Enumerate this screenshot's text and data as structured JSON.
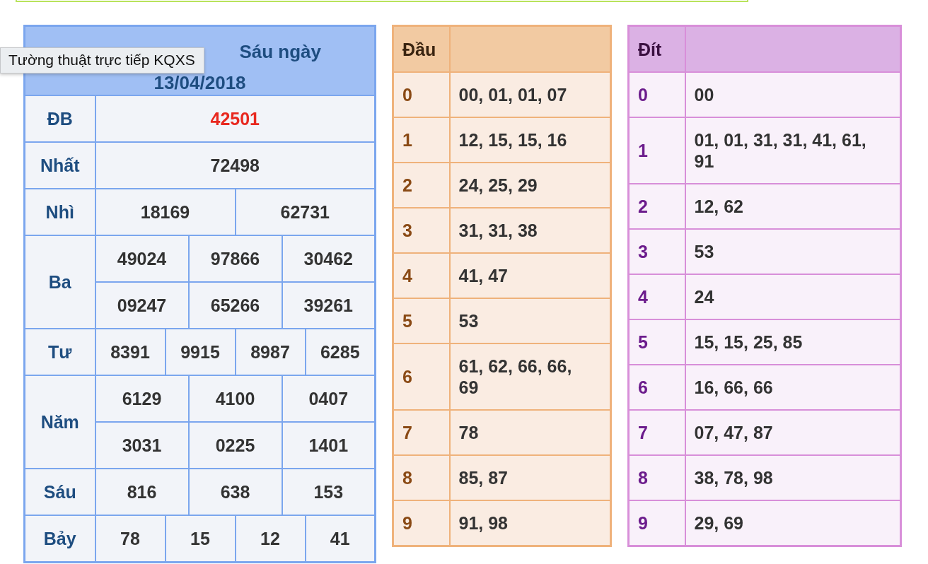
{
  "results": {
    "title_lines": [
      "Sáu ngày",
      "13/04/2018"
    ],
    "prizes": [
      {
        "label": "ĐB",
        "special": true,
        "rows": [
          [
            "42501"
          ]
        ]
      },
      {
        "label": "Nhất",
        "special": false,
        "rows": [
          [
            "72498"
          ]
        ]
      },
      {
        "label": "Nhì",
        "special": false,
        "rows": [
          [
            "18169",
            "62731"
          ]
        ]
      },
      {
        "label": "Ba",
        "special": false,
        "rows": [
          [
            "49024",
            "97866",
            "30462"
          ],
          [
            "09247",
            "65266",
            "39261"
          ]
        ]
      },
      {
        "label": "Tư",
        "special": false,
        "rows": [
          [
            "8391",
            "9915",
            "8987",
            "6285"
          ]
        ]
      },
      {
        "label": "Năm",
        "special": false,
        "rows": [
          [
            "6129",
            "4100",
            "0407"
          ],
          [
            "3031",
            "0225",
            "1401"
          ]
        ]
      },
      {
        "label": "Sáu",
        "special": false,
        "rows": [
          [
            "816",
            "638",
            "153"
          ]
        ]
      },
      {
        "label": "Bảy",
        "special": false,
        "rows": [
          [
            "78",
            "15",
            "12",
            "41"
          ]
        ]
      }
    ]
  },
  "tooltip": "Tường thuật trực tiếp KQXS",
  "head_table": {
    "heading": "Đầu",
    "rows": [
      {
        "digit": "0",
        "numbers": "00, 01, 01, 07"
      },
      {
        "digit": "1",
        "numbers": "12, 15, 15, 16"
      },
      {
        "digit": "2",
        "numbers": "24, 25, 29"
      },
      {
        "digit": "3",
        "numbers": "31, 31, 38"
      },
      {
        "digit": "4",
        "numbers": "41, 47"
      },
      {
        "digit": "5",
        "numbers": "53"
      },
      {
        "digit": "6",
        "numbers": "61, 62, 66, 66, 69"
      },
      {
        "digit": "7",
        "numbers": "78"
      },
      {
        "digit": "8",
        "numbers": "85, 87"
      },
      {
        "digit": "9",
        "numbers": "91, 98"
      }
    ]
  },
  "tail_table": {
    "heading": "Đít",
    "rows": [
      {
        "digit": "0",
        "numbers": "00"
      },
      {
        "digit": "1",
        "numbers": "01, 01, 31, 31, 41, 61, 91"
      },
      {
        "digit": "2",
        "numbers": "12, 62"
      },
      {
        "digit": "3",
        "numbers": "53"
      },
      {
        "digit": "4",
        "numbers": "24"
      },
      {
        "digit": "5",
        "numbers": "15, 15, 25, 85"
      },
      {
        "digit": "6",
        "numbers": "16, 66, 66"
      },
      {
        "digit": "7",
        "numbers": "07, 47, 87"
      },
      {
        "digit": "8",
        "numbers": "38, 78, 98"
      },
      {
        "digit": "9",
        "numbers": "29, 69"
      }
    ]
  }
}
